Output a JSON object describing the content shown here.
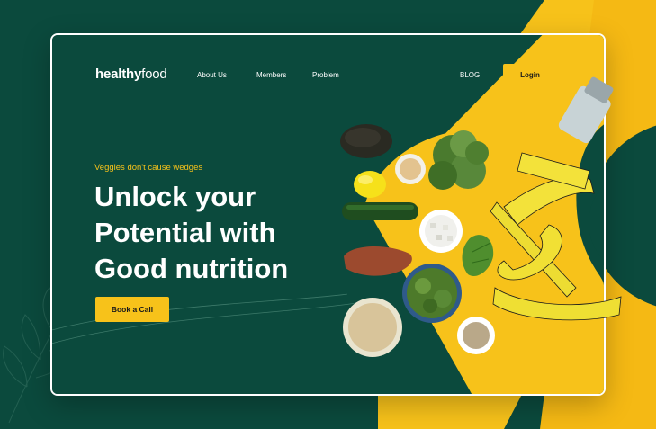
{
  "brand": {
    "name_bold": "healthy",
    "name_light": "food"
  },
  "nav": {
    "items": [
      "About Us",
      "Members",
      "Problem"
    ],
    "blog": "BLOG",
    "login": "Login"
  },
  "hero": {
    "tagline": "Veggies don't cause wedges",
    "headline_lines": [
      "Unlock your",
      "Potential with",
      "Good nutrition"
    ],
    "cta": "Book a Call"
  },
  "colors": {
    "background": "#0b4a3d",
    "accent": "#f7c21a",
    "text": "#ffffff"
  },
  "illustration": {
    "items": [
      "avocado-image",
      "lemon-image",
      "cucumber-image",
      "sweet-potato-image",
      "broccoli-image",
      "sauce-bowl-image",
      "feta-bowl-image",
      "herb-bowl-image",
      "quinoa-bowl-image",
      "seed-bowl-image",
      "salad-leaf-image",
      "measuring-tape-image",
      "shaker-image"
    ]
  }
}
